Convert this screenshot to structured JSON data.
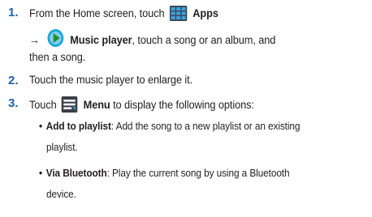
{
  "steps": [
    {
      "number": "1.",
      "line1_prefix": "From the Home screen, touch",
      "apps_icon": "apps-grid-icon",
      "apps_label": "Apps",
      "arrow": "→",
      "music_icon": "music-player-icon",
      "music_label": "Music player",
      "line2_suffix": ", touch a song or an album, and",
      "line3": "then a song."
    },
    {
      "number": "2.",
      "text": "Touch the music player to enlarge it."
    },
    {
      "number": "3.",
      "prefix": "Touch",
      "menu_icon": "menu-icon",
      "menu_label": "Menu",
      "suffix": " to display the following options:"
    }
  ],
  "options": [
    {
      "bullet": "•",
      "name": "Add to playlist",
      "desc_line1": ": Add the song to a new playlist or an existing",
      "desc_line2": "playlist."
    },
    {
      "bullet": "•",
      "name": "Via Bluetooth",
      "desc_line1": ": Play the current song by using a Bluetooth",
      "desc_line2": "device."
    }
  ],
  "colors": {
    "step_number": "#1f63a8",
    "text": "#231f20",
    "apps_icon_bg": "#3a4a5a",
    "apps_icon_cells": "#3aa3e0",
    "music_icon_ring": "#1aa6d8",
    "menu_icon_bg": "#3a4048"
  }
}
